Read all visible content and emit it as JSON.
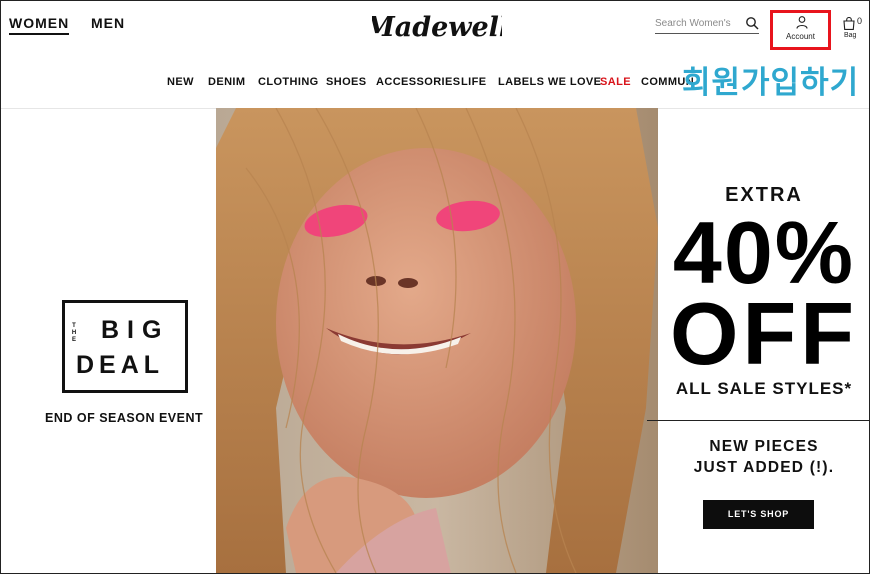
{
  "header": {
    "gender_tabs": [
      "WOMEN",
      "MEN"
    ],
    "logo_text": "Madewell",
    "search": {
      "placeholder": "Search Women's",
      "icon": "search-icon"
    },
    "account": {
      "label": "Account",
      "icon": "user-icon",
      "highlight_color": "#e8141d"
    },
    "bag": {
      "label": "Bag",
      "count": "0",
      "icon": "shopping-bag-icon"
    }
  },
  "nav": {
    "items": [
      "NEW",
      "DENIM",
      "CLOTHING",
      "SHOES",
      "ACCESSORIES",
      "LIFE",
      "LABELS WE LOVE",
      "SALE",
      "COMMUN"
    ],
    "sale_color": "#d8131a"
  },
  "overlay": {
    "text": "회원가입하기",
    "color": "#2fa8cf"
  },
  "hero": {
    "bigdeal": {
      "the": "THE",
      "line1": "BIG",
      "line2": "DEAL"
    },
    "event": "END OF SEASON EVENT",
    "promo": {
      "extra": "EXTRA",
      "percent": "40%",
      "off": "OFF",
      "all_sale": "ALL SALE STYLES*",
      "new_pieces": "NEW PIECES",
      "just_added": "JUST ADDED (!).",
      "cta": "LET'S SHOP"
    }
  }
}
